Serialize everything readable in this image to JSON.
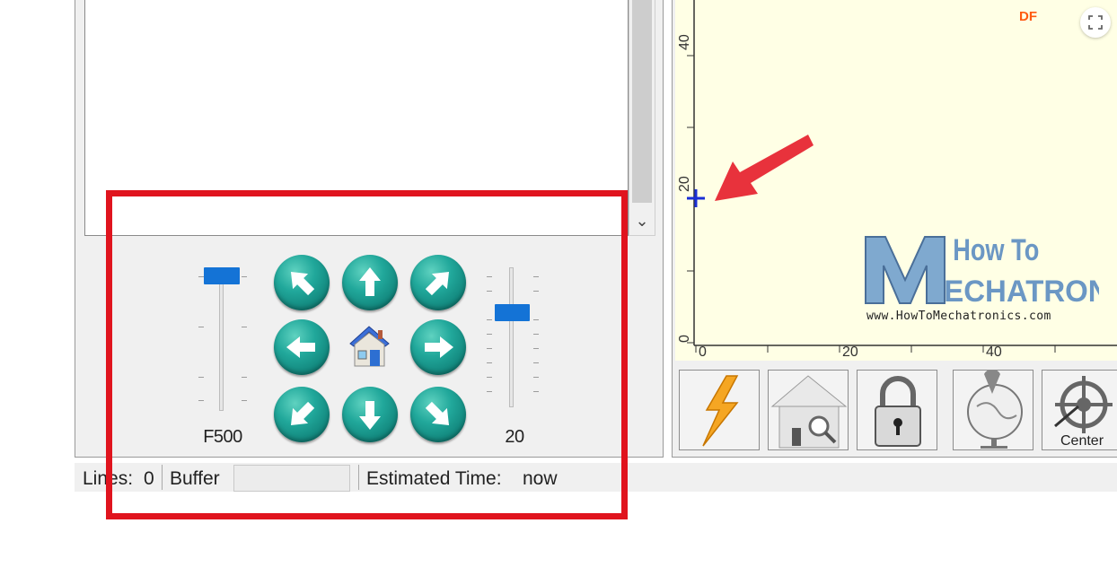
{
  "jog": {
    "feed_label": "F500",
    "step_label": "20",
    "feed_slider_level": 1.0,
    "step_slider_level": 0.7,
    "buttons": [
      "up-left",
      "up",
      "up-right",
      "left",
      "home",
      "right",
      "down-left",
      "down",
      "down-right"
    ]
  },
  "status": {
    "lines_label": "Lines:",
    "lines_value": "0",
    "buffer_label": "Buffer",
    "time_label": "Estimated Time:",
    "time_value": "now"
  },
  "plot": {
    "y_ticks": [
      "40",
      "20",
      "0"
    ],
    "x_ticks": [
      "0",
      "20",
      "40"
    ],
    "marker_color": "#1a2fd6"
  },
  "toolbar": {
    "center_label": "Center",
    "icons": [
      "lightning-icon",
      "home-zoom-icon",
      "padlock-icon",
      "globe-pin-icon",
      "center-helm-icon"
    ]
  },
  "watermark": {
    "line1": "How To",
    "line2": "ECHATRONICS",
    "url": "www.HowToMechatronics.com"
  },
  "badge": {
    "text": "DF"
  },
  "colors": {
    "highlight": "#e0141e",
    "arrow": "#e8323c",
    "jog": "#1a9e92",
    "slider": "#1473d6"
  }
}
